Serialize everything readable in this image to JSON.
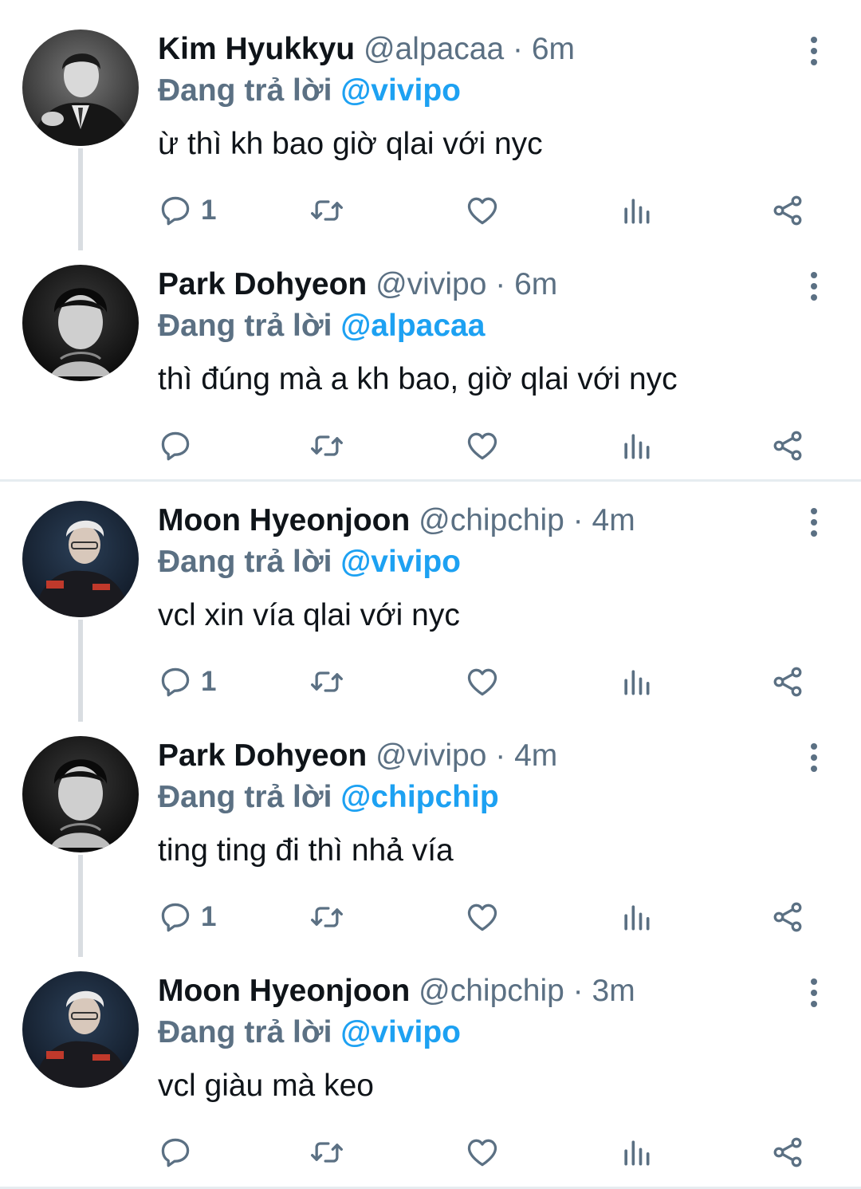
{
  "labels": {
    "replying_to": "Đang trả lời"
  },
  "colors": {
    "accent": "#1da1f2",
    "secondary_text": "#5b7083",
    "thread_line": "#d9dde1"
  },
  "tweets": [
    {
      "name": "Kim Hyukkyu",
      "handle": "@alpacaa",
      "dot": "·",
      "time": "6m",
      "reply_to": "@vivipo",
      "text": "ừ thì kh bao giờ qlai với nyc",
      "reply_count": "1",
      "avatar": "kim-hyukkyu-avatar"
    },
    {
      "name": "Park Dohyeon",
      "handle": "@vivipo",
      "dot": "·",
      "time": "6m",
      "reply_to": "@alpacaa",
      "text": "thì đúng mà a kh bao, giờ qlai với nyc",
      "reply_count": "",
      "avatar": "park-dohyeon-avatar"
    },
    {
      "name": "Moon Hyeonjoon",
      "handle": "@chipchip",
      "dot": "·",
      "time": "4m",
      "reply_to": "@vivipo",
      "text": "vcl xin vía qlai với nyc",
      "reply_count": "1",
      "avatar": "moon-hyeonjoon-avatar"
    },
    {
      "name": "Park Dohyeon",
      "handle": "@vivipo",
      "dot": "·",
      "time": "4m",
      "reply_to": "@chipchip",
      "text": "ting ting đi thì nhả vía",
      "reply_count": "1",
      "avatar": "park-dohyeon-avatar"
    },
    {
      "name": "Moon Hyeonjoon",
      "handle": "@chipchip",
      "dot": "·",
      "time": "3m",
      "reply_to": "@vivipo",
      "text": "vcl giàu mà keo",
      "reply_count": "",
      "avatar": "moon-hyeonjoon-avatar"
    }
  ]
}
